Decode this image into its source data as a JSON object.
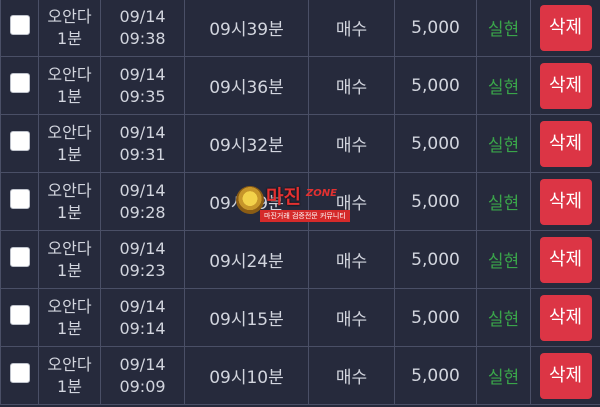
{
  "rows": [
    {
      "product_line1": "오안다",
      "product_line2": "1분",
      "date": "09/14",
      "time": "09:38",
      "round": "09시39분",
      "position": "매수",
      "amount": "5,000",
      "status": "실현",
      "delete_label": "삭제"
    },
    {
      "product_line1": "오안다",
      "product_line2": "1분",
      "date": "09/14",
      "time": "09:35",
      "round": "09시36분",
      "position": "매수",
      "amount": "5,000",
      "status": "실현",
      "delete_label": "삭제"
    },
    {
      "product_line1": "오안다",
      "product_line2": "1분",
      "date": "09/14",
      "time": "09:31",
      "round": "09시32분",
      "position": "매수",
      "amount": "5,000",
      "status": "실현",
      "delete_label": "삭제"
    },
    {
      "product_line1": "오안다",
      "product_line2": "1분",
      "date": "09/14",
      "time": "09:28",
      "round": "09시29분",
      "position": "매수",
      "amount": "5,000",
      "status": "실현",
      "delete_label": "삭제"
    },
    {
      "product_line1": "오안다",
      "product_line2": "1분",
      "date": "09/14",
      "time": "09:23",
      "round": "09시24분",
      "position": "매수",
      "amount": "5,000",
      "status": "실현",
      "delete_label": "삭제"
    },
    {
      "product_line1": "오안다",
      "product_line2": "1분",
      "date": "09/14",
      "time": "09:14",
      "round": "09시15분",
      "position": "매수",
      "amount": "5,000",
      "status": "실현",
      "delete_label": "삭제"
    },
    {
      "product_line1": "오안다",
      "product_line2": "1분",
      "date": "09/14",
      "time": "09:09",
      "round": "09시10분",
      "position": "매수",
      "amount": "5,000",
      "status": "실현",
      "delete_label": "삭제"
    }
  ],
  "watermark": {
    "title": "마진",
    "tail": "ZONE",
    "subtitle": "마진거래 검증전문 커뮤니티"
  },
  "colors": {
    "background": "#262a3c",
    "delete_button": "#dc3545",
    "status_text": "#3aa54a",
    "grid_line": "#4a4f66"
  }
}
